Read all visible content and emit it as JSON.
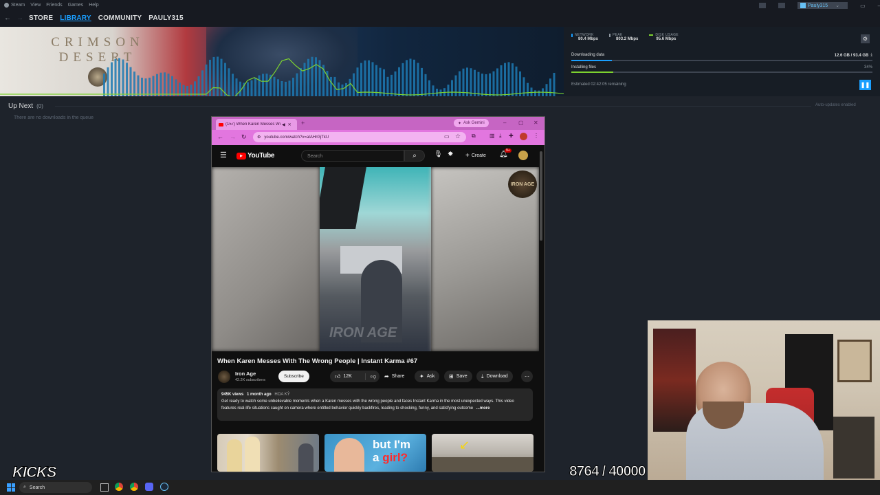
{
  "steam": {
    "menu": [
      "Steam",
      "View",
      "Friends",
      "Games",
      "Help"
    ],
    "nav": [
      "STORE",
      "LIBRARY",
      "COMMUNITY",
      "PAULY315"
    ],
    "active_nav": "LIBRARY",
    "username": "Pauly315",
    "game_logo_line1": "CRIMSON",
    "game_logo_line2": "DESERT",
    "stats": {
      "network_label": "NETWORK",
      "network_value": "80.4 Mbps",
      "peak_label": "PEAK",
      "peak_value": "803.2 Mbps",
      "disk_label": "DISK USAGE",
      "disk_value": "95.6 Mbps"
    },
    "download": {
      "downloading_label": "Downloading data",
      "downloading_progress_value": "12.6 GB / 93.4 GB",
      "downloading_fraction": 0.135,
      "installing_label": "Installing files",
      "installing_percent_text": "34%",
      "installing_fraction": 0.14,
      "remaining": "Estimated 02:42:05 remaining"
    },
    "up_next_label": "Up Next",
    "up_next_count": "(0)",
    "queue_empty": "There are no downloads in the queue",
    "auto_updates": "Auto-updates enabled",
    "accent_color": "#1a9fff"
  },
  "browser": {
    "tab_title": "(157) When Karen Messes Wi",
    "ask_gemini": "Ask Gemini",
    "url": "youtube.com/watch?v=aIAHrGjTkU",
    "youtube_logo": "YouTube",
    "search_placeholder": "Search",
    "create_label": "Create",
    "notif_count": "9+",
    "video_watermark": "IRON AGE",
    "channel_badge": "IRON AGE",
    "video_title": "When Karen Messes With The Wrong People | Instant Karma #67",
    "channel_name": "Iron Age",
    "subscribers": "42.2K subscribers",
    "subscribe_label": "Subscribe",
    "likes": "12K",
    "share_label": "Share",
    "ask_label": "Ask",
    "save_label": "Save",
    "download_label": "Download",
    "views": "945K views",
    "posted": "1 month ago",
    "location": "HOA KỲ",
    "description": "Get ready to watch some unbelievable moments when a Karen messes with the wrong people and faces Instant Karma in the most unexpected ways. This video features real-life situations caught on camera where entitled behavior quickly backfires, leading to shocking, funny, and satisfying outcome",
    "more_label": "...more",
    "thumb2_line1": "but I'm",
    "thumb2_line2_a": "a ",
    "thumb2_line2_b": "girl?",
    "theme_color": "#e276df"
  },
  "overlay": {
    "kicks_label": "KICKS",
    "counter": "8764 / 40000"
  },
  "taskbar": {
    "search_label": "Search"
  }
}
